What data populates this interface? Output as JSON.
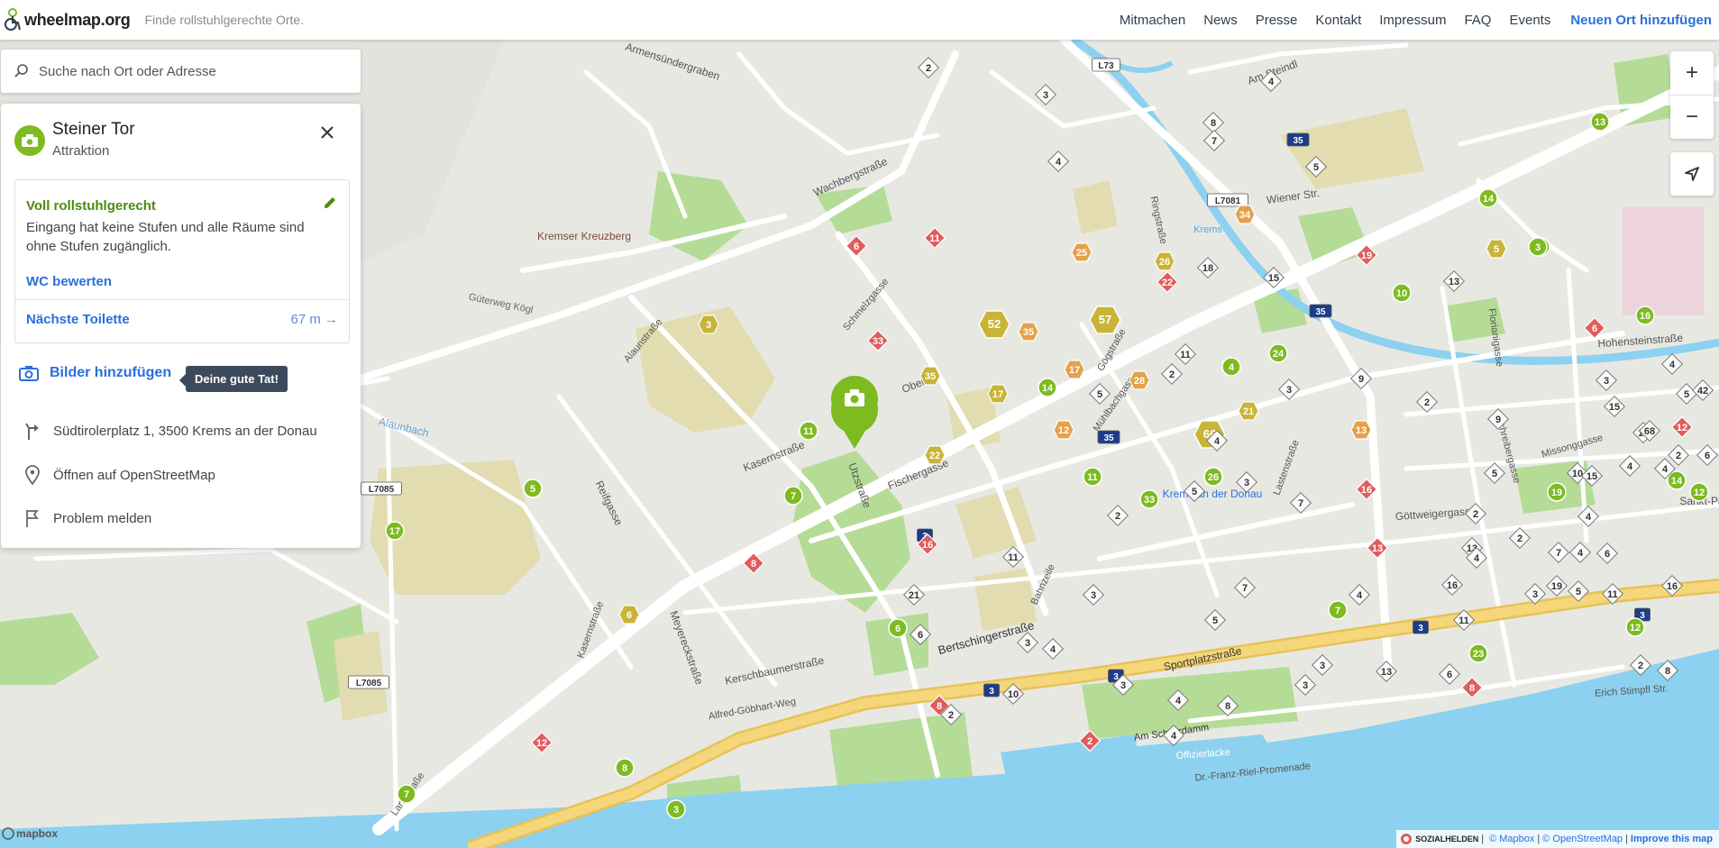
{
  "header": {
    "logo_text": "wheelmap.org",
    "claim": "Finde rollstuhlgerechte Orte.",
    "nav": [
      {
        "label": "Mitmachen"
      },
      {
        "label": "News"
      },
      {
        "label": "Presse"
      },
      {
        "label": "Kontakt"
      },
      {
        "label": "Impressum"
      },
      {
        "label": "FAQ"
      },
      {
        "label": "Events"
      }
    ],
    "primary_action": "Neuen Ort hinzufügen"
  },
  "search": {
    "placeholder": "Suche nach Ort oder Adresse"
  },
  "place": {
    "name": "Steiner Tor",
    "category": "Attraktion",
    "category_icon": "camera-icon",
    "category_color": "#7dbb20",
    "accessibility": {
      "title": "Voll rollstuhlgerecht",
      "description": "Eingang hat keine Stufen und alle Räume sind ohne Stufen zugänglich.",
      "color": "#4c8a0d"
    },
    "wc_link": "WC bewerten",
    "toilet": {
      "label": "Nächste Toilette",
      "distance": "67 m →"
    },
    "add_photos": "Bilder hinzufügen",
    "tooltip": "Deine gute Tat!",
    "address": "Südtirolerplatz 1, 3500 Krems an der Donau",
    "osm_link": "Öffnen auf OpenStreetMap",
    "report": "Problem melden"
  },
  "controls": {
    "zoom_in": "+",
    "zoom_out": "−"
  },
  "attribution": {
    "brand": "SOZIALHELDEN",
    "mapbox": "© Mapbox",
    "osm": "© OpenStreetMap",
    "improve": "Improve this map",
    "logo": "mapbox"
  },
  "map": {
    "colors": {
      "base": "#e8e8e3",
      "road": "#ffffff",
      "highway": "#f5cf63",
      "water": "#8cd1f0",
      "park": "#a8d98a",
      "green_marker": "#7dbb20",
      "yellow_marker": "#c9b437",
      "orange_marker": "#e5a14a",
      "red_marker": "#e05c5c"
    },
    "place_labels": [
      {
        "text": "Armensündergraben"
      },
      {
        "text": "Wachbergstraße"
      },
      {
        "text": "Kremser Kreuzberg"
      },
      {
        "text": "Güterweg Kögl"
      },
      {
        "text": "Alaunbach"
      },
      {
        "text": "Kasernstraße"
      },
      {
        "text": "Reifgasse"
      },
      {
        "text": "Meyereckstraße"
      },
      {
        "text": "Kerschbaumerstraße"
      },
      {
        "text": "Alfred-Göbhart-Weg"
      },
      {
        "text": "Utzstraße"
      },
      {
        "text": "Fischergasse"
      },
      {
        "text": "Obere"
      },
      {
        "text": "Bahnzeile"
      },
      {
        "text": "Bertschingerstraße"
      },
      {
        "text": "Sportplatzstraße"
      },
      {
        "text": "Am Schutzdamm"
      },
      {
        "text": "Dr.-Franz-Riel-Promenade"
      },
      {
        "text": "Krems an der Donau"
      },
      {
        "text": "Göttweigergasse"
      },
      {
        "text": "Wiener Str."
      },
      {
        "text": "Hohensteinstraße"
      },
      {
        "text": "Am Steindl"
      },
      {
        "text": "Krems"
      },
      {
        "text": "Erich Stimpfl Str."
      },
      {
        "text": "Sankt-Pa"
      },
      {
        "text": "Offizierlacke"
      },
      {
        "text": "Landstraße"
      },
      {
        "text": "Mühlbachgasse"
      },
      {
        "text": "Kasernstraße"
      },
      {
        "text": "Lastenstraße"
      },
      {
        "text": "Schreibergasse"
      },
      {
        "text": "Missonggasse"
      },
      {
        "text": "Florianigasse"
      },
      {
        "text": "Schmelzgasse"
      },
      {
        "text": "Alaunstraße"
      },
      {
        "text": "Ringstraße"
      },
      {
        "text": "Gögstraße"
      }
    ],
    "road_shields": [
      "L73",
      "L7081",
      "L7085",
      "L7085",
      "35",
      "35",
      "35",
      "3",
      "3",
      "3",
      "3",
      "3"
    ],
    "markers": [
      {
        "type": "green",
        "n": "3"
      },
      {
        "type": "green",
        "n": "14"
      },
      {
        "type": "green",
        "n": "5"
      },
      {
        "type": "green",
        "n": "17"
      },
      {
        "type": "green",
        "n": "11"
      },
      {
        "type": "green",
        "n": "7"
      },
      {
        "type": "green",
        "n": "6"
      },
      {
        "type": "green",
        "n": "14"
      },
      {
        "type": "green",
        "n": "11"
      },
      {
        "type": "green",
        "n": "33"
      },
      {
        "type": "green",
        "n": "26"
      },
      {
        "type": "green",
        "n": "4"
      },
      {
        "type": "green",
        "n": "24"
      },
      {
        "type": "green",
        "n": "10"
      },
      {
        "type": "green",
        "n": "13"
      },
      {
        "type": "green",
        "n": "14"
      },
      {
        "type": "green",
        "n": "3"
      },
      {
        "type": "green",
        "n": "16"
      },
      {
        "type": "green",
        "n": "19"
      },
      {
        "type": "green",
        "n": "12"
      },
      {
        "type": "green",
        "n": "23"
      },
      {
        "type": "green",
        "n": "12"
      },
      {
        "type": "green",
        "n": "7"
      },
      {
        "type": "green",
        "n": "8"
      },
      {
        "type": "green",
        "n": "3"
      },
      {
        "type": "green",
        "n": "7"
      },
      {
        "type": "yellow",
        "n": "3"
      },
      {
        "type": "yellow",
        "n": "6"
      },
      {
        "type": "yellow",
        "n": "35"
      },
      {
        "type": "yellow",
        "n": "22"
      },
      {
        "type": "yellow",
        "n": "17"
      },
      {
        "type": "yellow",
        "n": "21"
      },
      {
        "type": "yellow",
        "n": "26"
      },
      {
        "type": "yellow",
        "n": "5"
      },
      {
        "type": "yellow-hex",
        "n": "52"
      },
      {
        "type": "yellow-hex",
        "n": "57"
      },
      {
        "type": "yellow-hex",
        "n": "66"
      },
      {
        "type": "orange",
        "n": "25"
      },
      {
        "type": "orange",
        "n": "34"
      },
      {
        "type": "orange",
        "n": "35"
      },
      {
        "type": "orange",
        "n": "17"
      },
      {
        "type": "orange",
        "n": "28"
      },
      {
        "type": "orange",
        "n": "12"
      },
      {
        "type": "orange",
        "n": "13"
      },
      {
        "type": "red",
        "n": "6"
      },
      {
        "type": "red",
        "n": "11"
      },
      {
        "type": "red",
        "n": "33"
      },
      {
        "type": "red",
        "n": "22"
      },
      {
        "type": "red",
        "n": "19"
      },
      {
        "type": "red",
        "n": "6"
      },
      {
        "type": "red",
        "n": "16"
      },
      {
        "type": "red",
        "n": "13"
      },
      {
        "type": "red",
        "n": "8"
      },
      {
        "type": "red",
        "n": "16"
      },
      {
        "type": "red",
        "n": "12"
      },
      {
        "type": "red",
        "n": "8"
      },
      {
        "type": "red",
        "n": "2"
      },
      {
        "type": "red",
        "n": "12"
      },
      {
        "type": "red",
        "n": "8"
      },
      {
        "type": "gray",
        "n": "2"
      },
      {
        "type": "gray",
        "n": "4"
      },
      {
        "type": "gray",
        "n": "3"
      },
      {
        "type": "gray",
        "n": "8"
      },
      {
        "type": "gray",
        "n": "7"
      },
      {
        "type": "gray",
        "n": "4"
      },
      {
        "type": "gray",
        "n": "5"
      },
      {
        "type": "gray",
        "n": "18"
      },
      {
        "type": "gray",
        "n": "15"
      },
      {
        "type": "gray",
        "n": "13"
      },
      {
        "type": "gray",
        "n": "11"
      },
      {
        "type": "gray",
        "n": "2"
      },
      {
        "type": "gray",
        "n": "3"
      },
      {
        "type": "gray",
        "n": "5"
      },
      {
        "type": "gray",
        "n": "4"
      },
      {
        "type": "gray",
        "n": "5"
      },
      {
        "type": "gray",
        "n": "3"
      },
      {
        "type": "gray",
        "n": "2"
      },
      {
        "type": "gray",
        "n": "21"
      },
      {
        "type": "gray",
        "n": "11"
      },
      {
        "type": "gray",
        "n": "6"
      },
      {
        "type": "gray",
        "n": "3"
      },
      {
        "type": "gray",
        "n": "2"
      },
      {
        "type": "gray",
        "n": "10"
      },
      {
        "type": "gray",
        "n": "3"
      },
      {
        "type": "gray",
        "n": "4"
      },
      {
        "type": "gray",
        "n": "3"
      },
      {
        "type": "gray",
        "n": "6"
      },
      {
        "type": "gray",
        "n": "13"
      },
      {
        "type": "gray",
        "n": "3"
      },
      {
        "type": "gray",
        "n": "4"
      },
      {
        "type": "gray",
        "n": "8"
      },
      {
        "type": "gray",
        "n": "4"
      },
      {
        "type": "gray",
        "n": "5"
      },
      {
        "type": "gray",
        "n": "3"
      },
      {
        "type": "gray",
        "n": "7"
      },
      {
        "type": "gray",
        "n": "7"
      },
      {
        "type": "gray",
        "n": "4"
      },
      {
        "type": "gray",
        "n": "11"
      },
      {
        "type": "gray",
        "n": "3"
      },
      {
        "type": "gray",
        "n": "16"
      },
      {
        "type": "gray",
        "n": "19"
      },
      {
        "type": "gray",
        "n": "13"
      },
      {
        "type": "gray",
        "n": "5"
      },
      {
        "type": "gray",
        "n": "2"
      },
      {
        "type": "gray",
        "n": "4"
      },
      {
        "type": "gray",
        "n": "10"
      },
      {
        "type": "gray",
        "n": "4"
      },
      {
        "type": "gray",
        "n": "15"
      },
      {
        "type": "gray",
        "n": "3"
      },
      {
        "type": "gray",
        "n": "2"
      },
      {
        "type": "gray",
        "n": "9"
      },
      {
        "type": "gray",
        "n": "9"
      },
      {
        "type": "gray",
        "n": "4"
      },
      {
        "type": "gray",
        "n": "6"
      },
      {
        "type": "gray",
        "n": "2"
      },
      {
        "type": "gray",
        "n": "8"
      },
      {
        "type": "gray",
        "n": "5"
      },
      {
        "type": "gray",
        "n": "11"
      },
      {
        "type": "gray",
        "n": "16"
      },
      {
        "type": "gray",
        "n": "7"
      },
      {
        "type": "gray",
        "n": "2"
      },
      {
        "type": "gray",
        "n": "4"
      },
      {
        "type": "gray",
        "n": "15"
      },
      {
        "type": "gray",
        "n": "6"
      },
      {
        "type": "gray",
        "n": "2"
      },
      {
        "type": "gray",
        "n": "4"
      },
      {
        "type": "gray",
        "n": "13"
      },
      {
        "type": "gray",
        "n": "5"
      },
      {
        "type": "gray",
        "n": "4"
      },
      {
        "type": "gray",
        "n": "68"
      },
      {
        "type": "gray",
        "n": "42"
      }
    ]
  }
}
